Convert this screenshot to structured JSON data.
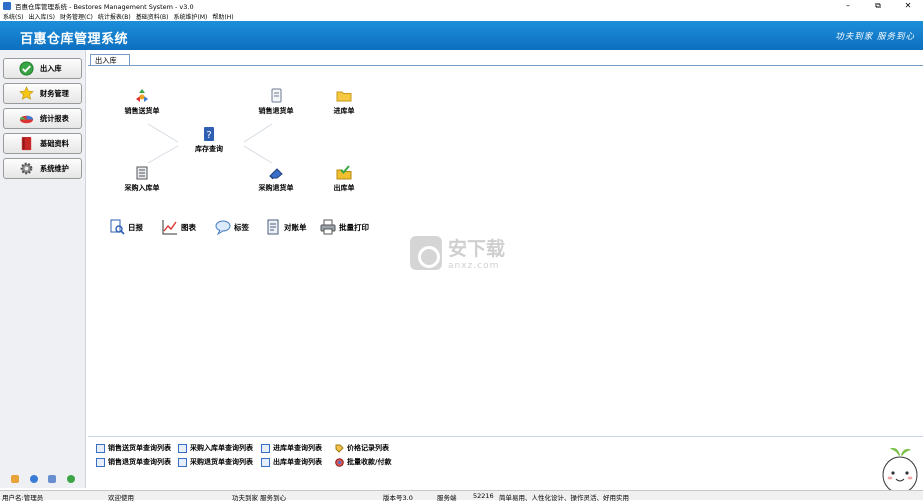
{
  "window": {
    "title": "百惠仓库管理系统 - Bestores Management System - v3.0",
    "controls": [
      "minimize-icon",
      "restore-icon",
      "close-icon"
    ]
  },
  "menubar": {
    "items": [
      "系统(S)",
      "出入库(S)",
      "财务管理(C)",
      "统计报表(B)",
      "基础资料(B)",
      "系统维护(M)",
      "帮助(H)"
    ]
  },
  "banner": {
    "app_name": "百惠仓库管理系统",
    "slogan": "功夫到家  服务到心"
  },
  "sidebar": {
    "items": [
      {
        "label": "出入库",
        "icon": "check-circle-icon"
      },
      {
        "label": "财务管理",
        "icon": "star-icon"
      },
      {
        "label": "统计报表",
        "icon": "pie-chart-icon"
      },
      {
        "label": "基础资料",
        "icon": "book-icon"
      },
      {
        "label": "系统维护",
        "icon": "gear-icon"
      }
    ]
  },
  "tabs": {
    "active": "出入库"
  },
  "flow": {
    "sales_delivery": "销售送货单",
    "sales_return": "销售退货单",
    "stock_in": "进库单",
    "inventory_query": "库存查询",
    "purchase_in": "采购入库单",
    "purchase_return": "采购退货单",
    "stock_out": "出库单"
  },
  "toolbar": {
    "daily": "日报",
    "chart": "图表",
    "labels": "标签",
    "statement": "对账单",
    "batch_print": "批量打印"
  },
  "watermark": {
    "text": "安下载",
    "url": "anxz.com"
  },
  "quicklinks": {
    "row1": [
      "销售送货单查询列表",
      "采购入库单查询列表",
      "进库单查询列表",
      "价格记录列表"
    ],
    "row2": [
      "销售退货单查询列表",
      "采购退货单查询列表",
      "出库单查询列表",
      "批量收款/付款"
    ]
  },
  "statusbar": {
    "user": "用户名:管理员",
    "welcome": "欢迎使用",
    "motto": "功夫到家 服务到心",
    "version": "版本号3.0",
    "service_label": "服务端",
    "port": "52216",
    "tagline": "简单易用、人性化设计、操作灵活、好用实用"
  },
  "colors": {
    "banner": "#0c6fbf",
    "tab_border": "#7a9ac6"
  }
}
